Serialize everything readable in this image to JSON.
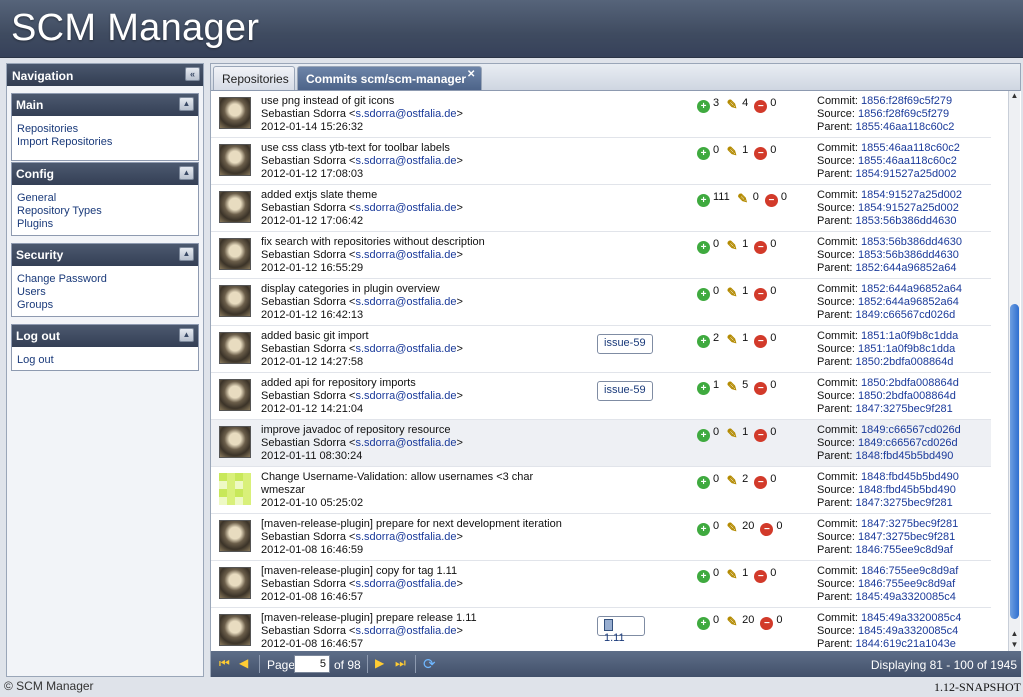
{
  "app_title": "SCM Manager",
  "navigation": {
    "title": "Navigation",
    "sections": [
      {
        "title": "Main",
        "items": [
          "Repositories",
          "Import Repositories"
        ]
      },
      {
        "title": "Config",
        "items": [
          "General",
          "Repository Types",
          "Plugins"
        ]
      },
      {
        "title": "Security",
        "items": [
          "Change Password",
          "Users",
          "Groups"
        ]
      },
      {
        "title": "Log out",
        "items": [
          "Log out"
        ]
      }
    ]
  },
  "tabs": [
    {
      "label": "Repositories"
    },
    {
      "label": "Commits scm/scm-manager"
    }
  ],
  "commits": [
    {
      "message": "use png instead of git icons",
      "author": "Sebastian Sdorra <",
      "email": "s.sdorra@ostfalia.de",
      "author_end": ">",
      "date": "2012-01-14 15:26:32",
      "tag": "",
      "added": "3",
      "modified": "4",
      "deleted": "0",
      "commit": "1856:f28f69c5f279",
      "source": "1856:f28f69c5f279",
      "parent": "1855:46aa118c60c2"
    },
    {
      "message": "use css class ytb-text for toolbar labels",
      "author": "Sebastian Sdorra <",
      "email": "s.sdorra@ostfalia.de",
      "author_end": ">",
      "date": "2012-01-12 17:08:03",
      "tag": "",
      "added": "0",
      "modified": "1",
      "deleted": "0",
      "commit": "1855:46aa118c60c2",
      "source": "1855:46aa118c60c2",
      "parent": "1854:91527a25d002"
    },
    {
      "message": "added extjs slate theme",
      "author": "Sebastian Sdorra <",
      "email": "s.sdorra@ostfalia.de",
      "author_end": ">",
      "date": "2012-01-12 17:06:42",
      "tag": "",
      "added": "111",
      "modified": "0",
      "deleted": "0",
      "commit": "1854:91527a25d002",
      "source": "1854:91527a25d002",
      "parent": "1853:56b386dd4630"
    },
    {
      "message": "fix search with repositories without description",
      "author": "Sebastian Sdorra <",
      "email": "s.sdorra@ostfalia.de",
      "author_end": ">",
      "date": "2012-01-12 16:55:29",
      "tag": "",
      "added": "0",
      "modified": "1",
      "deleted": "0",
      "commit": "1853:56b386dd4630",
      "source": "1853:56b386dd4630",
      "parent": "1852:644a96852a64"
    },
    {
      "message": "display categories in plugin overview",
      "author": "Sebastian Sdorra <",
      "email": "s.sdorra@ostfalia.de",
      "author_end": ">",
      "date": "2012-01-12 16:42:13",
      "tag": "",
      "added": "0",
      "modified": "1",
      "deleted": "0",
      "commit": "1852:644a96852a64",
      "source": "1852:644a96852a64",
      "parent": "1849:c66567cd026d"
    },
    {
      "message": "added basic git import",
      "author": "Sebastian Sdorra <",
      "email": "s.sdorra@ostfalia.de",
      "author_end": ">",
      "date": "2012-01-12 14:27:58",
      "tag": "issue-59",
      "added": "2",
      "modified": "1",
      "deleted": "0",
      "commit": "1851:1a0f9b8c1dda",
      "source": "1851:1a0f9b8c1dda",
      "parent": "1850:2bdfa008864d"
    },
    {
      "message": "added api for repository imports",
      "author": "Sebastian Sdorra <",
      "email": "s.sdorra@ostfalia.de",
      "author_end": ">",
      "date": "2012-01-12 14:21:04",
      "tag": "issue-59",
      "added": "1",
      "modified": "5",
      "deleted": "0",
      "commit": "1850:2bdfa008864d",
      "source": "1850:2bdfa008864d",
      "parent": "1847:3275bec9f281"
    },
    {
      "message": "improve javadoc of repository resource",
      "author": "Sebastian Sdorra <",
      "email": "s.sdorra@ostfalia.de",
      "author_end": ">",
      "date": "2012-01-11 08:30:24",
      "tag": "",
      "added": "0",
      "modified": "1",
      "deleted": "0",
      "commit": "1849:c66567cd026d",
      "source": "1849:c66567cd026d",
      "parent": "1848:fbd45b5bd490"
    },
    {
      "message": "Change Username-Validation: allow usernames <3 char",
      "author": "wmeszar",
      "email": "",
      "author_end": "",
      "date": "2012-01-10 05:25:02",
      "tag": "",
      "added": "0",
      "modified": "2",
      "deleted": "0",
      "commit": "1848:fbd45b5bd490",
      "source": "1848:fbd45b5bd490",
      "parent": "1847:3275bec9f281"
    },
    {
      "message": "[maven-release-plugin] prepare for next development iteration",
      "author": "Sebastian Sdorra <",
      "email": "s.sdorra@ostfalia.de",
      "author_end": ">",
      "date": "2012-01-08 16:46:59",
      "tag": "",
      "added": "0",
      "modified": "20",
      "deleted": "0",
      "commit": "1847:3275bec9f281",
      "source": "1847:3275bec9f281",
      "parent": "1846:755ee9c8d9af"
    },
    {
      "message": "[maven-release-plugin] copy for tag 1.11",
      "author": "Sebastian Sdorra <",
      "email": "s.sdorra@ostfalia.de",
      "author_end": ">",
      "date": "2012-01-08 16:46:57",
      "tag": "",
      "added": "0",
      "modified": "1",
      "deleted": "0",
      "commit": "1846:755ee9c8d9af",
      "source": "1846:755ee9c8d9af",
      "parent": "1845:49a3320085c4"
    },
    {
      "message": "[maven-release-plugin] prepare release 1.11",
      "author": "Sebastian Sdorra <",
      "email": "s.sdorra@ostfalia.de",
      "author_end": ">",
      "date": "2012-01-08 16:46:57",
      "tag": "1.11",
      "added": "0",
      "modified": "20",
      "deleted": "0",
      "commit": "1845:49a3320085c4",
      "source": "1845:49a3320085c4",
      "parent": "1844:619c21a1043e"
    }
  ],
  "labels": {
    "commit": "Commit: ",
    "source": "Source: ",
    "parent": "Parent: "
  },
  "pager": {
    "page_label": "Page",
    "current_page": "5",
    "of_label": "of 98",
    "displaying": "Displaying 81 - 100 of 1945"
  },
  "footer": {
    "copyright": "© SCM Manager",
    "version": "1.12-SNAPSHOT"
  },
  "icons": {
    "added": "plus-icon",
    "modified": "pencil-icon",
    "deleted": "minus-icon"
  },
  "colors": {
    "header": "#3f4b60",
    "link": "#1a3a9a",
    "accent": "#4d6489"
  }
}
